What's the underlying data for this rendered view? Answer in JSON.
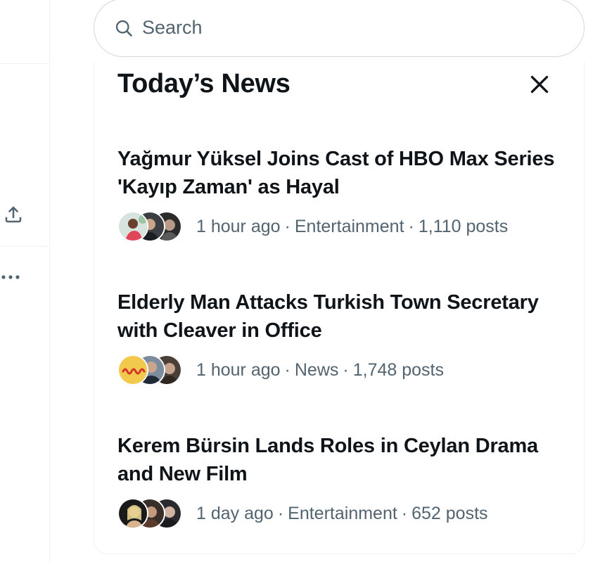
{
  "search": {
    "placeholder": "Search"
  },
  "news": {
    "title": "Today’s News",
    "items": [
      {
        "headline": "Yağmur Yüksel Joins Cast of HBO Max Series 'Kayıp Zaman' as Hayal",
        "time": "1 hour ago",
        "category": "Entertainment",
        "posts": "1,110 posts"
      },
      {
        "headline": "Elderly Man Attacks Turkish Town Secretary with Cleaver in Office",
        "time": "1 hour ago",
        "category": "News",
        "posts": "1,748 posts"
      },
      {
        "headline": "Kerem Bürsin Lands Roles in Ceylan Drama and New Film",
        "time": "1 day ago",
        "category": "Entertainment",
        "posts": "652 posts"
      }
    ]
  },
  "colors": {
    "text_primary": "#0f1419",
    "text_secondary": "#536471",
    "border": "#cfd9de",
    "divider": "#eff3f4"
  },
  "icons": [
    "search-icon",
    "close-icon",
    "share-icon",
    "more-icon"
  ]
}
